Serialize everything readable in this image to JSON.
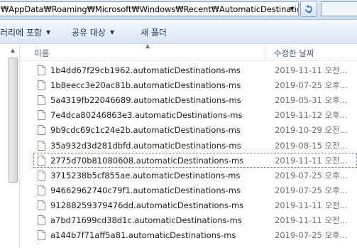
{
  "address_bar": {
    "path": "₩AppData₩Roaming₩Microsoft₩Windows₩Recent₩AutomaticDestinations"
  },
  "toolbar": {
    "library_label": "러리에 포함",
    "share_label": "공유 대상",
    "new_folder_label": "새 폴더"
  },
  "columns": {
    "name": "이름",
    "date_modified": "수정한 날짜"
  },
  "files": [
    {
      "name": "1b4dd67f29cb1962.automaticDestinations-ms",
      "date": "2019-11-11 오전..."
    },
    {
      "name": "1b8eecc3e20ac81b.automaticDestinations-ms",
      "date": "2019-07-25 오후..."
    },
    {
      "name": "5a4319fb22046689.automaticDestinations-ms",
      "date": "2019-05-31 오후..."
    },
    {
      "name": "7e4dca80246863e3.automaticDestinations-ms",
      "date": "2019-11-12 오후..."
    },
    {
      "name": "9b9cdc69c1c24e2b.automaticDestinations-ms",
      "date": "2019-10-29 오전..."
    },
    {
      "name": "35a932d3d281dbfd.automaticDestinations-ms",
      "date": "2019-08-15 오전..."
    },
    {
      "name": "2775d70b81080608.automaticDestinations-ms",
      "date": "2019-11-11 오전..."
    },
    {
      "name": "3715238b5cf855ae.automaticDestinations-ms",
      "date": "2019-07-25 오후..."
    },
    {
      "name": "94662962740c79f1.automaticDestinations-ms",
      "date": "2019-07-25 오후..."
    },
    {
      "name": "91288259379476dd.automaticDestinations-ms",
      "date": "2019-11-11 오전..."
    },
    {
      "name": "a7bd71699cd38d1c.automaticDestinations-ms",
      "date": "2019-11-11 오전..."
    },
    {
      "name": "a144b7f71aff5a81.automaticDestinations-ms",
      "date": "2019-07-25 오후..."
    }
  ],
  "focused_file": "2775d70b81080608.automaticDestinations-ms",
  "colors": {
    "toolbar_text": "#1e395b",
    "header_text": "#4c607a",
    "date_text": "#6d6d6d"
  }
}
